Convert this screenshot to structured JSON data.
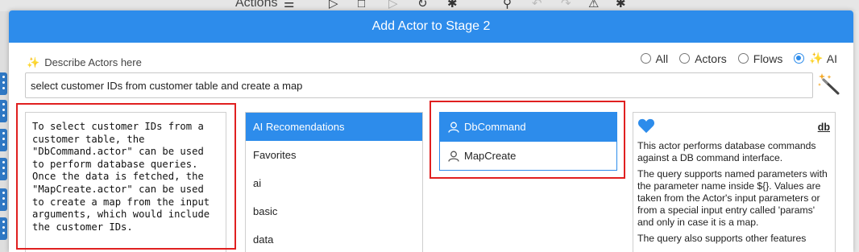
{
  "background": {
    "toolbar_label": "Actions",
    "icons": [
      "menu-icon",
      "play-icon",
      "stop-icon",
      "step-icon",
      "debug-icon",
      "search-icon",
      "undo-icon",
      "redo-icon",
      "warning-icon",
      "pin-icon"
    ]
  },
  "dialog": {
    "title": "Add Actor to Stage 2",
    "describe_label": "Describe Actors here",
    "filters": [
      {
        "label": "All",
        "selected": false
      },
      {
        "label": "Actors",
        "selected": false
      },
      {
        "label": "Flows",
        "selected": false
      },
      {
        "label": "AI",
        "selected": true
      }
    ],
    "query_value": "select customer IDs from customer table and create a map"
  },
  "ai_response": "To select customer IDs from a customer table, the \"DbCommand.actor\" can be used to perform database queries. Once the data is fetched, the \"MapCreate.actor\" can be used to create a map from the input arguments, which would include the customer IDs.",
  "categories": [
    "AI Recomendations",
    "Favorites",
    "ai",
    "basic",
    "data"
  ],
  "selected_category": "AI Recomendations",
  "actors": [
    "DbCommand",
    "MapCreate"
  ],
  "selected_actor": "DbCommand",
  "detail": {
    "name": "db",
    "paragraphs": [
      "This actor performs database commands against a DB command interface.",
      "The query supports named parameters with the parameter name inside ${}. Values are taken from the Actor's input parameters or from a special input entry called 'params' and only in case it is a map.",
      "The query also supports other features"
    ]
  },
  "colors": {
    "accent": "#2d8ceb",
    "highlight": "#e02020"
  }
}
